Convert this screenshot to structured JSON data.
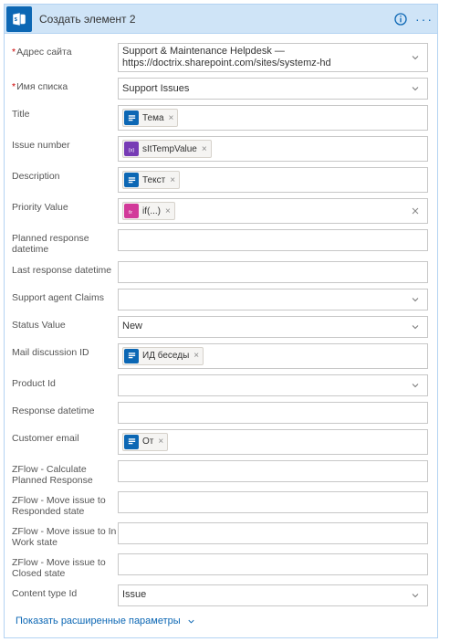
{
  "header": {
    "title": "Создать элемент 2"
  },
  "fields": {
    "siteAddress": {
      "label": "Адрес сайта",
      "required": true,
      "line1": "Support & Maintenance Helpdesk —",
      "line2": "https://doctrix.sharepoint.com/sites/systemz-hd"
    },
    "listName": {
      "label": "Имя списка",
      "required": true,
      "value": "Support Issues"
    },
    "title": {
      "label": "Title",
      "tokenType": "blue",
      "tokenText": "Тема"
    },
    "issueNum": {
      "label": "Issue number",
      "tokenType": "purple",
      "tokenText": "sItTempValue"
    },
    "desc": {
      "label": "Description",
      "tokenType": "blue",
      "tokenText": "Текст"
    },
    "priority": {
      "label": "Priority Value",
      "tokenType": "pink",
      "tokenText": "if(...)"
    },
    "plannedResp": {
      "label": "Planned response datetime"
    },
    "lastResp": {
      "label": "Last response datetime"
    },
    "agent": {
      "label": "Support agent Claims"
    },
    "status": {
      "label": "Status Value",
      "value": "New"
    },
    "mailId": {
      "label": "Mail discussion ID",
      "tokenType": "blue",
      "tokenText": "ИД беседы"
    },
    "productId": {
      "label": "Product Id"
    },
    "respDt": {
      "label": "Response datetime"
    },
    "custEmail": {
      "label": "Customer email",
      "tokenType": "blue",
      "tokenText": "От"
    },
    "zCalc": {
      "label": "ZFlow - Calculate Planned Response"
    },
    "zResp": {
      "label": "ZFlow - Move issue to Responded state"
    },
    "zWork": {
      "label": "ZFlow - Move issue to In Work state"
    },
    "zClosed": {
      "label": "ZFlow - Move issue to Closed state"
    },
    "contentType": {
      "label": "Content type Id",
      "value": "Issue"
    }
  },
  "footer": {
    "advanced": "Показать расширенные параметры"
  }
}
